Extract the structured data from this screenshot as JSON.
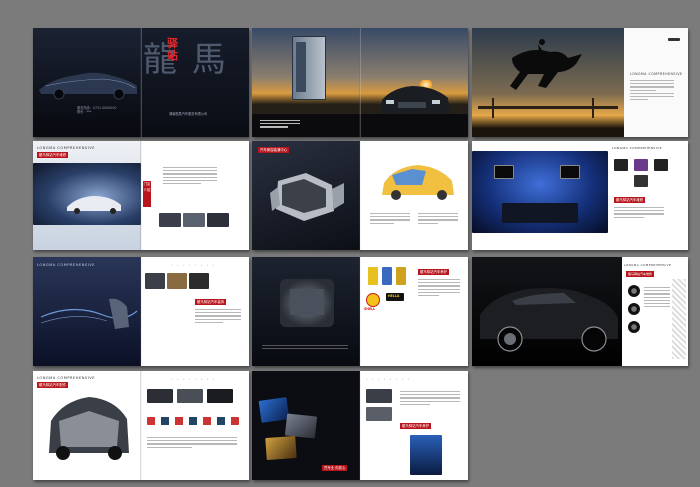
{
  "spreads": {
    "s1": {
      "title_big": "龍 馬",
      "title_red": "驿站",
      "address": "湖南龍馬汽车服务有限公司",
      "cover_lines": [
        "服务热线：0731-0000000",
        "联系：***"
      ]
    },
    "s3": {
      "brand": "LONGMA COMPREHENSIVE"
    },
    "s4": {
      "brand": "LONGMA COMPREHENSIVE",
      "tag": "龍马驿站汽车维修",
      "side_tag": "门店介绍"
    },
    "s5": {
      "tag": "汽车美容装潢中心"
    },
    "s6": {
      "brand": "LONGMA COMPREHENSIVE",
      "tag": "龍马驿站汽车维修"
    },
    "s7": {
      "brand": "LONGMA COMPREHENSIVE",
      "tag": "龍马驿站汽车装饰"
    },
    "s8": {
      "tag": "龍马驿站汽车养护",
      "logos": [
        "SHELL",
        "HELLA"
      ]
    },
    "s9": {
      "brand": "LONGMA COMPREHENSIVE",
      "tag": "龍马驿站汽车维修"
    },
    "s10": {
      "brand": "LONGMA COMPREHENSIVE",
      "tag": "龍马驿站汽车配件"
    },
    "s11": {
      "tag": "龍马驿站汽车养护",
      "slogan": "凭专业 你放心"
    }
  },
  "colors": {
    "background": "#7b7b7b",
    "accent": "#b8161c",
    "dark": "#141a26"
  }
}
